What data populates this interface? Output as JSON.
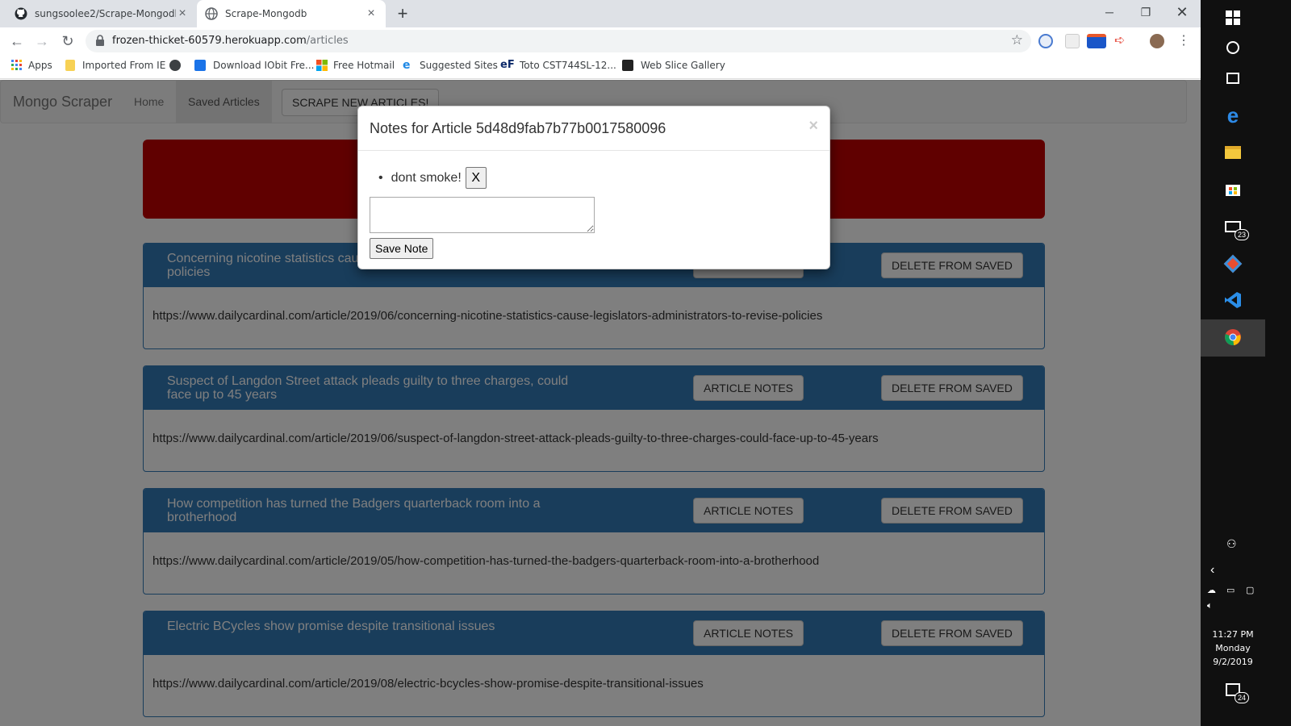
{
  "browser": {
    "tabs": [
      {
        "title": "sungsoolee2/Scrape-Mongodb",
        "icon": "github-icon"
      },
      {
        "title": "Scrape-Mongodb",
        "icon": "globe-icon"
      }
    ],
    "address_bar": {
      "host": "frozen-thicket-60579.herokuapp.com",
      "path": "/articles"
    },
    "bookmarks": [
      {
        "label": "Apps",
        "icon": "apps-grid-icon"
      },
      {
        "label": "Imported From IE",
        "icon": "folder-icon"
      },
      {
        "label": "",
        "icon": "globe-icon"
      },
      {
        "label": "Download IObit Fre...",
        "icon": "iobit-icon"
      },
      {
        "label": "Free Hotmail",
        "icon": "windows-logo-icon"
      },
      {
        "label": "Suggested Sites",
        "icon": "ie-icon"
      },
      {
        "label": "Toto CST744SL-12...",
        "icon": "ef-icon"
      },
      {
        "label": "Web Slice Gallery",
        "icon": "web-slice-icon"
      }
    ]
  },
  "site": {
    "brand": "Mongo Scraper",
    "nav": {
      "home": "Home",
      "saved": "Saved Articles",
      "scrape": "SCRAPE NEW ARTICLES!"
    },
    "colors": {
      "jumbotron": "#c00000",
      "panel": "#337ab7"
    },
    "articles": [
      {
        "title": "Concerning nicotine statistics cause legislators, administrators to revise policies",
        "visible_title_lines": [
          "Concerning nicotine statistics caus",
          "policies"
        ],
        "notes_button": "ARTICLE NOTES",
        "delete_button": "DELETE FROM SAVED",
        "link": "https://www.dailycardinal.com/article/2019/06/concerning-nicotine-statistics-cause-legislators-administrators-to-revise-policies"
      },
      {
        "title": "Suspect of Langdon Street attack pleads guilty to three charges, could face up to 45 years",
        "notes_button": "ARTICLE NOTES",
        "delete_button": "DELETE FROM SAVED",
        "link": "https://www.dailycardinal.com/article/2019/06/suspect-of-langdon-street-attack-pleads-guilty-to-three-charges-could-face-up-to-45-years"
      },
      {
        "title": "How competition has turned the Badgers quarterback room into a brotherhood",
        "notes_button": "ARTICLE NOTES",
        "delete_button": "DELETE FROM SAVED",
        "link": "https://www.dailycardinal.com/article/2019/05/how-competition-has-turned-the-badgers-quarterback-room-into-a-brotherhood"
      },
      {
        "title": "Electric BCycles show promise despite transitional issues",
        "notes_button": "ARTICLE NOTES",
        "delete_button": "DELETE FROM SAVED",
        "link": "https://www.dailycardinal.com/article/2019/08/electric-bcycles-show-promise-despite-transitional-issues"
      }
    ]
  },
  "modal": {
    "title": "Notes for Article 5d48d9fab7b77b0017580096",
    "close": "×",
    "notes": [
      {
        "text": "dont smoke!",
        "delete_label": "X"
      }
    ],
    "textarea_value": "",
    "save_label": "Save Note"
  },
  "taskbar": {
    "badges": {
      "mail": "23",
      "notifications": "24"
    },
    "clock": {
      "time": "11:27 PM",
      "day": "Monday",
      "date": "9/2/2019"
    }
  }
}
